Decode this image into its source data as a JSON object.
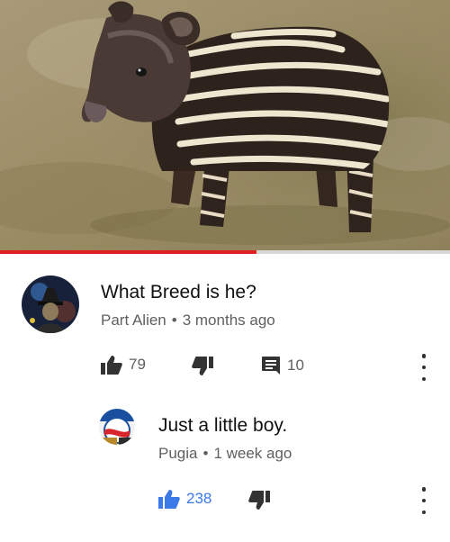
{
  "video": {
    "progress_fraction": 0.57
  },
  "comments": [
    {
      "author": "Part Alien",
      "time": "3 months ago",
      "text": "What Breed is he?",
      "likes": "79",
      "replies": "10",
      "like_icon": "thumbs-up-icon",
      "dislike_icon": "thumbs-down-icon",
      "reply_icon": "comment-icon",
      "more_icon": "more-vert-icon"
    },
    {
      "author": "Pugia",
      "time": "1 week ago",
      "text": "Just a little boy.",
      "likes": "238",
      "like_color": "#3b79e8",
      "like_icon": "thumbs-up-icon",
      "dislike_icon": "thumbs-down-icon",
      "more_icon": "more-vert-icon"
    }
  ],
  "colors": {
    "progress": "#e02020",
    "liked": "#3b79e8",
    "text": "#111111",
    "meta": "#5f5f5f"
  }
}
